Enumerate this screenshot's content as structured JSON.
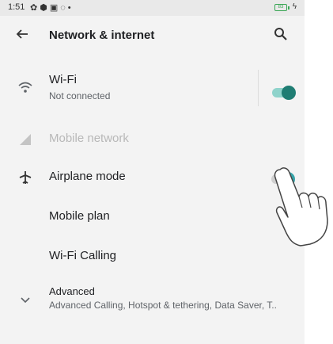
{
  "status_bar": {
    "time": "1:51",
    "icons": [
      "settings-icon",
      "shield-icon",
      "notification-icon",
      "sync-icon",
      "dot-icon"
    ],
    "battery_label": "83"
  },
  "app_bar": {
    "title": "Network & internet"
  },
  "items": [
    {
      "id": "wifi",
      "title": "Wi-Fi",
      "subtitle": "Not connected",
      "icon": "wifi-icon",
      "toggle": true,
      "toggle_state": "on"
    },
    {
      "id": "mobile-network",
      "title": "Mobile network",
      "icon": "signal-icon",
      "disabled": true
    },
    {
      "id": "airplane-mode",
      "title": "Airplane mode",
      "icon": "airplane-icon",
      "toggle": true,
      "toggle_state": "off"
    },
    {
      "id": "mobile-plan",
      "title": "Mobile plan"
    },
    {
      "id": "wifi-calling",
      "title": "Wi-Fi Calling"
    },
    {
      "id": "advanced",
      "title": "Advanced",
      "subtitle": "Advanced Calling, Hotspot & tethering, Data Saver, T..",
      "icon": "chevron-down-icon"
    }
  ],
  "colors": {
    "accent": "#1f7d73",
    "accent_track": "#8fd3cb",
    "background": "#f3f3f3",
    "disabled_text": "#b8b8b8"
  }
}
